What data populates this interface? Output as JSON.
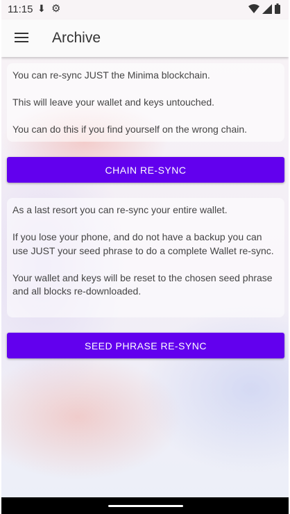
{
  "status_bar": {
    "time": "11:15"
  },
  "app_bar": {
    "title": "Archive"
  },
  "chain_card": {
    "line1": "You can re-sync JUST the Minima blockchain.",
    "line2": " This will leave your wallet and keys untouched.",
    "line3": " You can do this if you find yourself on the wrong chain."
  },
  "chain_button": {
    "label": "CHAIN RE-SYNC"
  },
  "seed_card": {
    "line1": "As a last resort you can re-sync your entire wallet.",
    "line2": " If you lose your phone, and do not have a backup you can use JUST your seed phrase to do a complete Wallet re-sync.",
    "line3": " Your wallet and keys will be reset to the chosen seed phrase and all blocks re-downloaded."
  },
  "seed_button": {
    "label": "SEED PHRASE RE-SYNC"
  },
  "colors": {
    "accent": "#6200ee",
    "app_bar": "#fafafa"
  }
}
